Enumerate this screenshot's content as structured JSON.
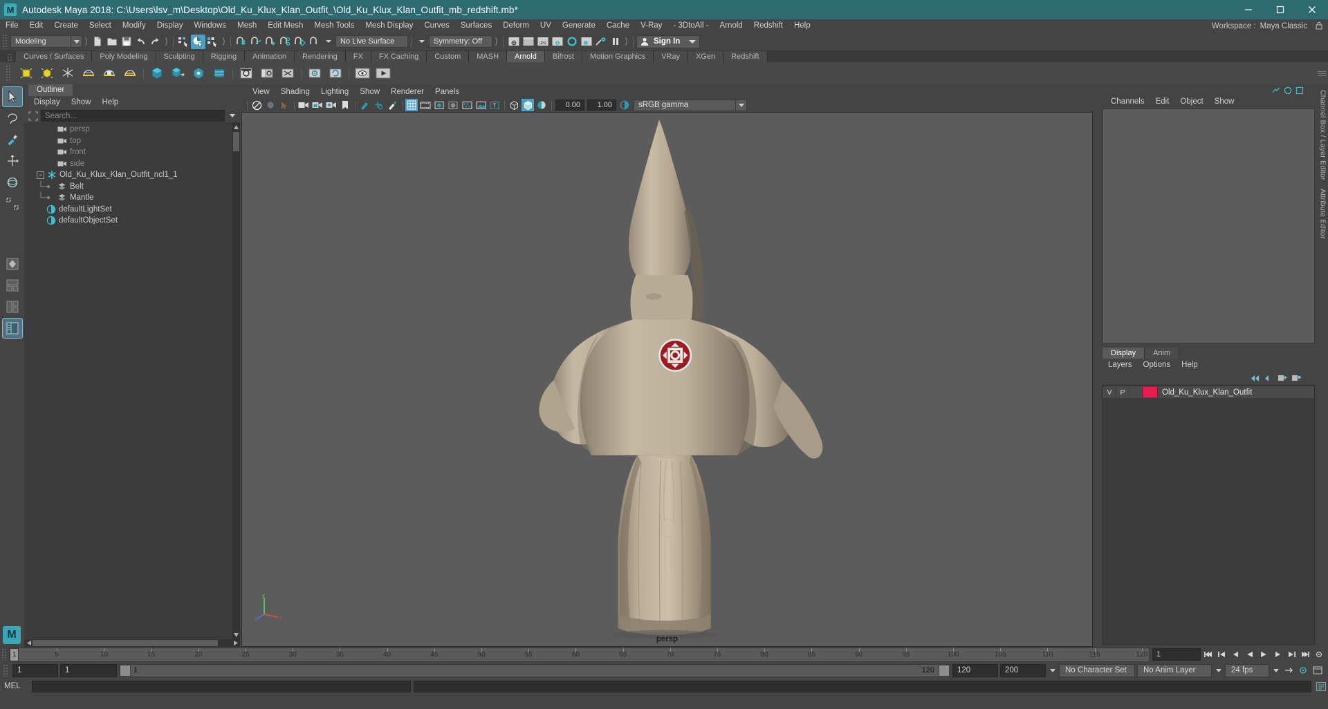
{
  "window": {
    "title": "Autodesk Maya 2018: C:\\Users\\lsv_m\\Desktop\\Old_Ku_Klux_Klan_Outfit_\\Old_Ku_Klux_Klan_Outfit_mb_redshift.mb*",
    "minimize": "–",
    "maximize": "☐",
    "close": "✕",
    "titlebar_color": "#2d6a72"
  },
  "menubar": {
    "items": [
      "File",
      "Edit",
      "Create",
      "Select",
      "Modify",
      "Display",
      "Windows",
      "Mesh",
      "Edit Mesh",
      "Mesh Tools",
      "Mesh Display",
      "Curves",
      "Surfaces",
      "Deform",
      "UV",
      "Generate",
      "Cache",
      "V-Ray",
      "- 3DtoAll -",
      "Arnold",
      "Redshift",
      "Help"
    ],
    "workspace_label": "Workspace :",
    "workspace_value": "Maya Classic"
  },
  "statusbar": {
    "mode": "Modeling",
    "live_surface": "No Live Surface",
    "symmetry": "Symmetry: Off",
    "input_a": "0.00",
    "input_b": "1.00",
    "signin": "Sign In"
  },
  "shelf": {
    "tabs": [
      "Curves / Surfaces",
      "Poly Modeling",
      "Sculpting",
      "Rigging",
      "Animation",
      "Rendering",
      "FX",
      "FX Caching",
      "Custom",
      "MASH",
      "Arnold",
      "Bifrost",
      "Motion Graphics",
      "VRay",
      "XGen",
      "Redshift"
    ],
    "active_tab": "Arnold"
  },
  "outliner": {
    "tab": "Outliner",
    "menu": [
      "Display",
      "Show",
      "Help"
    ],
    "search_placeholder": "Search...",
    "search_value": "",
    "items": [
      {
        "label": "persp",
        "icon": "camera-icon",
        "depth": 1,
        "dim": true,
        "expander": false
      },
      {
        "label": "top",
        "icon": "camera-icon",
        "depth": 1,
        "dim": true,
        "expander": false
      },
      {
        "label": "front",
        "icon": "camera-icon",
        "depth": 1,
        "dim": true,
        "expander": false
      },
      {
        "label": "side",
        "icon": "camera-icon",
        "depth": 1,
        "dim": true,
        "expander": false
      },
      {
        "label": "Old_Ku_Klux_Klan_Outfit_ncl1_1",
        "icon": "group-star-icon",
        "depth": 0,
        "dim": false,
        "expander": true
      },
      {
        "label": "Belt",
        "icon": "mesh-icon",
        "depth": 2,
        "dim": false,
        "expander": false
      },
      {
        "label": "Mantle",
        "icon": "mesh-icon",
        "depth": 2,
        "dim": false,
        "expander": false
      },
      {
        "label": "defaultLightSet",
        "icon": "set-icon",
        "depth": 1,
        "dim": false,
        "expander": false
      },
      {
        "label": "defaultObjectSet",
        "icon": "set-icon",
        "depth": 1,
        "dim": false,
        "expander": false
      }
    ]
  },
  "viewport": {
    "menu": [
      "View",
      "Shading",
      "Lighting",
      "Show",
      "Renderer",
      "Panels"
    ],
    "exposure": "0.00",
    "gamma": "1.00",
    "color_space": "sRGB gamma",
    "camera_label": "persp",
    "axis": {
      "x": "x",
      "y": "y",
      "z": "z"
    }
  },
  "channelbox": {
    "menu": [
      "Channels",
      "Edit",
      "Object",
      "Show"
    ],
    "side_label": "Channel Box / Layer Editor",
    "side_label_2": "Attribute Editor"
  },
  "layereditor": {
    "tabs": [
      "Display",
      "Anim"
    ],
    "active_tab": "Display",
    "menu": [
      "Layers",
      "Options",
      "Help"
    ],
    "columns": [
      "V",
      "P"
    ],
    "layers": [
      {
        "v": "",
        "p": "",
        "color": "#e21f50",
        "name": "Old_Ku_Klux_Klan_Outfit"
      }
    ]
  },
  "timeslider": {
    "current_frame": "1",
    "ticks": [
      "5",
      "10",
      "15",
      "20",
      "25",
      "30",
      "35",
      "40",
      "45",
      "50",
      "55",
      "60",
      "65",
      "70",
      "75",
      "80",
      "85",
      "90",
      "95",
      "100",
      "105",
      "110",
      "115",
      "120"
    ],
    "field_value": "1"
  },
  "rangeslider": {
    "start": "1",
    "end": "1",
    "range_start": "1",
    "range_end": "120",
    "anim_start": "120",
    "anim_end": "200",
    "character_set": "No Character Set",
    "anim_layer": "No Anim Layer",
    "fps": "24 fps"
  },
  "command": {
    "label": "MEL",
    "value": ""
  }
}
